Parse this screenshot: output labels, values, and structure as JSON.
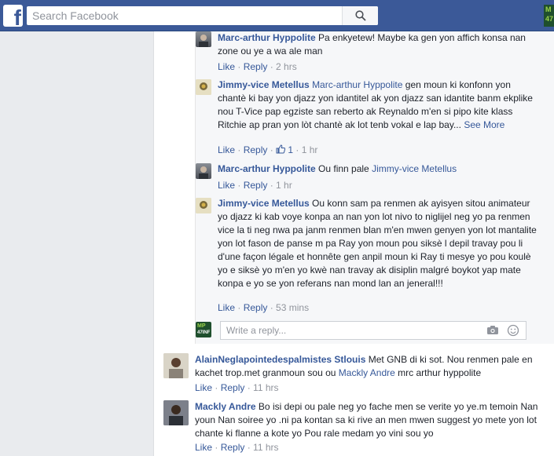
{
  "header": {
    "logo_letter": "f",
    "search_placeholder": "Search Facebook",
    "thumb_text_1": "M",
    "thumb_text_2": "47"
  },
  "comments": [
    {
      "author": "Marc-arthur Hyppolite",
      "text": " Pa enkyetew! Maybe ka gen yon affich konsa nan zone ou ye a wa ale man",
      "like": "Like",
      "reply": "Reply",
      "time": "2 hrs"
    },
    {
      "author": "Jimmy-vice Metellus",
      "mention": "Marc-arthur Hyppolite",
      "text": " gen moun ki konfonn yon chantè ki bay yon djazz yon idantitel ak yon djazz san idantite banm ekplike nou T-Vice pap egziste san reberto ak Reynaldo m'en si pipo kite klass Ritchie ap pran yon lòt chantè ak lot tenb vokal e lap bay...",
      "see_more": "See More",
      "like": "Like",
      "reply": "Reply",
      "reaction_count": "1",
      "time": "1 hr"
    },
    {
      "author": "Marc-arthur Hyppolite",
      "text": " Ou finn pale ",
      "mention": "Jimmy-vice Metellus",
      "like": "Like",
      "reply": "Reply",
      "time": "1 hr"
    },
    {
      "author": "Jimmy-vice Metellus",
      "text": " Ou konn sam pa renmen ak ayisyen sitou animateur yo djazz ki kab voye konpa an nan yon lot nivo to niglijel neg yo pa renmen vice la ti neg nwa pa janm renmen blan m'en mwen genyen yon lot mantalite yon lot fason de panse m pa Ray yon moun pou siksè l depil travay pou li d'une façon légale et honnête gen anpil moun ki Ray ti mesye yo pou koulè yo e siksè yo m'en yo kwè nan travay ak disiplin malgré boykot yap mate konpa e yo se yon referans nan mond lan an jeneral!!!",
      "like": "Like",
      "reply": "Reply",
      "time": "53 mins"
    },
    {
      "author": "AlainNeglapointedespalmistes Stlouis",
      "text": " Met GNB di ki sot. Nou renmen pale en kachet trop.met granmoun sou ou ",
      "mention": "Mackly Andre",
      "text_after": " mrc arthur hyppolite",
      "like": "Like",
      "reply": "Reply",
      "time": "11 hrs"
    },
    {
      "author": "Mackly Andre",
      "text": " Bo isi depi ou pale neg yo fache men se verite yo ye.m temoin Nan youn Nan soiree yo .ni pa kontan sa ki rive an men mwen suggest yo mete yon lot chante ki flanne a kote yo Pou rale medam yo vini sou yo",
      "like": "Like",
      "reply": "Reply",
      "time": "11 hrs"
    }
  ],
  "reply_box": {
    "placeholder": "Write a reply...",
    "avatar_text_1": "MP",
    "avatar_text_2": "47INF"
  },
  "colors": {
    "brand": "#3b5998",
    "link": "#365899",
    "meta": "#90949c"
  }
}
